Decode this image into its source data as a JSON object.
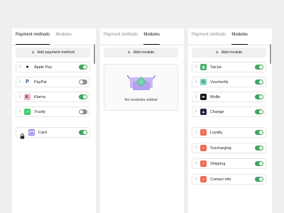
{
  "panel_a": {
    "tabs": [
      {
        "label": "Payment methods",
        "active": true
      },
      {
        "label": "Modules",
        "active": false
      }
    ],
    "add_button_label": "Add payment method",
    "rows": [
      {
        "label": "Apple Pay",
        "icon": "apple-pay-icon",
        "enabled": true
      },
      {
        "label": "PayPal",
        "icon": "paypal-icon",
        "enabled": false
      },
      {
        "label": "Klarna",
        "icon": "klarna-icon",
        "enabled": true
      },
      {
        "label": "Trustly",
        "icon": "trustly-icon",
        "enabled": false
      }
    ],
    "locked_row": {
      "label": "Card",
      "icon": "card-icon",
      "enabled": true
    }
  },
  "panel_b": {
    "tabs": [
      {
        "label": "Payment methods",
        "active": false
      },
      {
        "label": "Modules",
        "active": true
      }
    ],
    "add_button_label": "Add module",
    "empty_text": "No modules added"
  },
  "panel_c": {
    "tabs": [
      {
        "label": "Payment methods",
        "active": false
      },
      {
        "label": "Modules",
        "active": true
      }
    ],
    "add_button_label": "Add module",
    "group1": [
      {
        "label": "TaxJar",
        "icon": "taxjar-icon",
        "enabled": true
      },
      {
        "label": "Voucherify",
        "icon": "voucherify-icon",
        "enabled": true
      },
      {
        "label": "Mollie",
        "icon": "mollie-icon",
        "enabled": true
      },
      {
        "label": "Change",
        "icon": "change-icon",
        "enabled": true
      }
    ],
    "group2": [
      {
        "label": "Loyalty",
        "icon": "custom-module-icon",
        "enabled": true
      },
      {
        "label": "Surcharging",
        "icon": "custom-module-icon",
        "enabled": true
      },
      {
        "label": "Shipping",
        "icon": "custom-module-icon",
        "enabled": true
      },
      {
        "label": "Contact info",
        "icon": "custom-module-icon",
        "enabled": true
      }
    ]
  },
  "colors": {
    "toggle_on": "#3fa563",
    "toggle_off": "#8e8e8e",
    "background": "#efefef"
  }
}
